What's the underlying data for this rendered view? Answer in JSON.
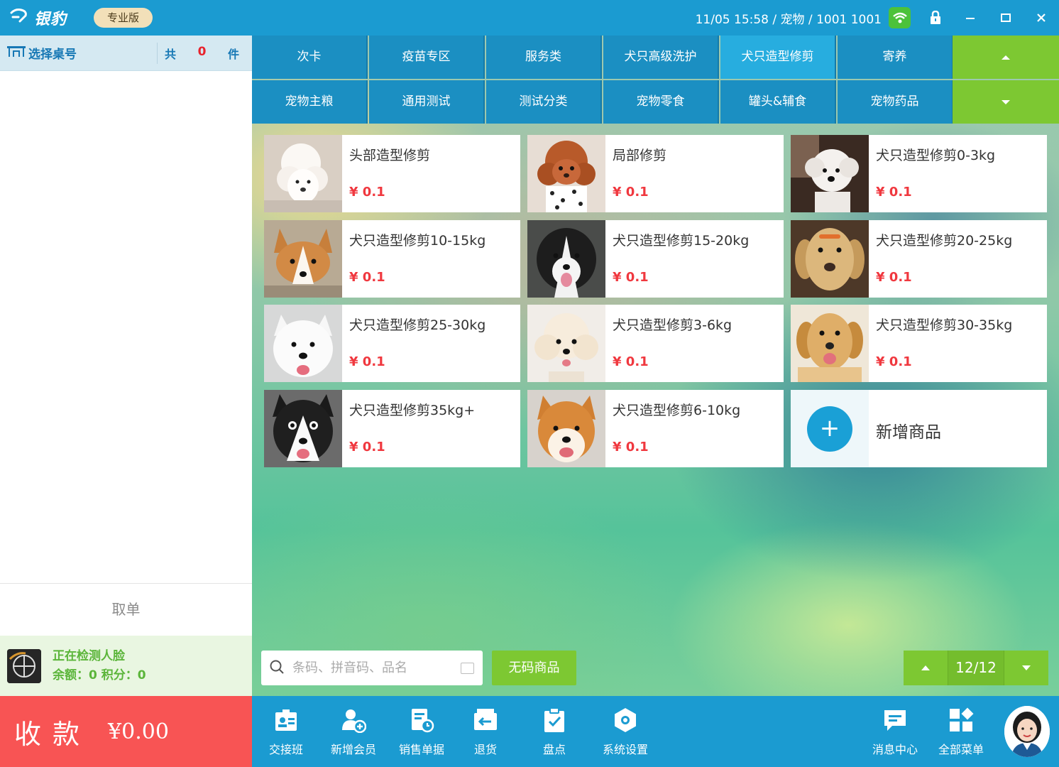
{
  "app": {
    "logo_text": "银豹",
    "edition": "专业版",
    "status": "11/05 15:58 / 宠物 / 1001 1001"
  },
  "left": {
    "table_select": "选择桌号",
    "count_prefix": "共",
    "count_value": "0",
    "count_suffix": "件",
    "cancel_order": "取单",
    "member_status": "正在检测人脸",
    "member_balance": "余额：0  积分：0",
    "pay_label": "收款",
    "pay_amount": "¥0.00"
  },
  "tabs": [
    {
      "label": "次卡",
      "active": false
    },
    {
      "label": "疫苗专区",
      "active": false
    },
    {
      "label": "服务类",
      "active": false
    },
    {
      "label": "犬只高级洗护",
      "active": false
    },
    {
      "label": "犬只造型修剪",
      "active": true
    },
    {
      "label": "寄养",
      "active": false
    },
    {
      "label": "宠物主粮",
      "active": false
    },
    {
      "label": "通用测试",
      "active": false
    },
    {
      "label": "测试分类",
      "active": false
    },
    {
      "label": "宠物零食",
      "active": false
    },
    {
      "label": "罐头&辅食",
      "active": false
    },
    {
      "label": "宠物药品",
      "active": false
    }
  ],
  "products": [
    {
      "name": "头部造型修剪",
      "price": "¥ 0.1",
      "photo": "white-poodle-photo"
    },
    {
      "name": "局部修剪",
      "price": "¥ 0.1",
      "photo": "brown-poodle-photo"
    },
    {
      "name": "犬只造型修剪0-3kg",
      "price": "¥ 0.1",
      "photo": "white-teddy-photo"
    },
    {
      "name": "犬只造型修剪10-15kg",
      "price": "¥ 0.1",
      "photo": "corgi-photo"
    },
    {
      "name": "犬只造型修剪15-20kg",
      "price": "¥ 0.1",
      "photo": "border-collie-photo"
    },
    {
      "name": "犬只造型修剪20-25kg",
      "price": "¥ 0.1",
      "photo": "labrador-photo"
    },
    {
      "name": "犬只造型修剪25-30kg",
      "price": "¥ 0.1",
      "photo": "samoyed-photo"
    },
    {
      "name": "犬只造型修剪3-6kg",
      "price": "¥ 0.1",
      "photo": "bichon-photo"
    },
    {
      "name": "犬只造型修剪30-35kg",
      "price": "¥ 0.1",
      "photo": "golden-retriever-photo"
    },
    {
      "name": "犬只造型修剪35kg+",
      "price": "¥ 0.1",
      "photo": "alaskan-malamute-photo"
    },
    {
      "name": "犬只造型修剪6-10kg",
      "price": "¥ 0.1",
      "photo": "shiba-inu-photo"
    }
  ],
  "add_product": "新增商品",
  "search": {
    "placeholder": "条码、拼音码、品名"
  },
  "no_barcode": "无码商品",
  "pager": {
    "label": "12/12"
  },
  "bottom": [
    {
      "label": "交接班",
      "icon": "handover-icon"
    },
    {
      "label": "新增会员",
      "icon": "add-member-icon"
    },
    {
      "label": "销售单据",
      "icon": "sales-receipt-icon"
    },
    {
      "label": "退货",
      "icon": "return-icon"
    },
    {
      "label": "盘点",
      "icon": "inventory-icon"
    },
    {
      "label": "系统设置",
      "icon": "settings-icon"
    },
    {
      "label": "消息中心",
      "icon": "message-icon"
    },
    {
      "label": "全部菜单",
      "icon": "all-menu-icon"
    }
  ],
  "colors": {
    "primary": "#1b9bd1",
    "accent_green": "#7dc832",
    "pay_red": "#f85454",
    "price_red": "#f0383f",
    "active_tab": "#27addf"
  }
}
